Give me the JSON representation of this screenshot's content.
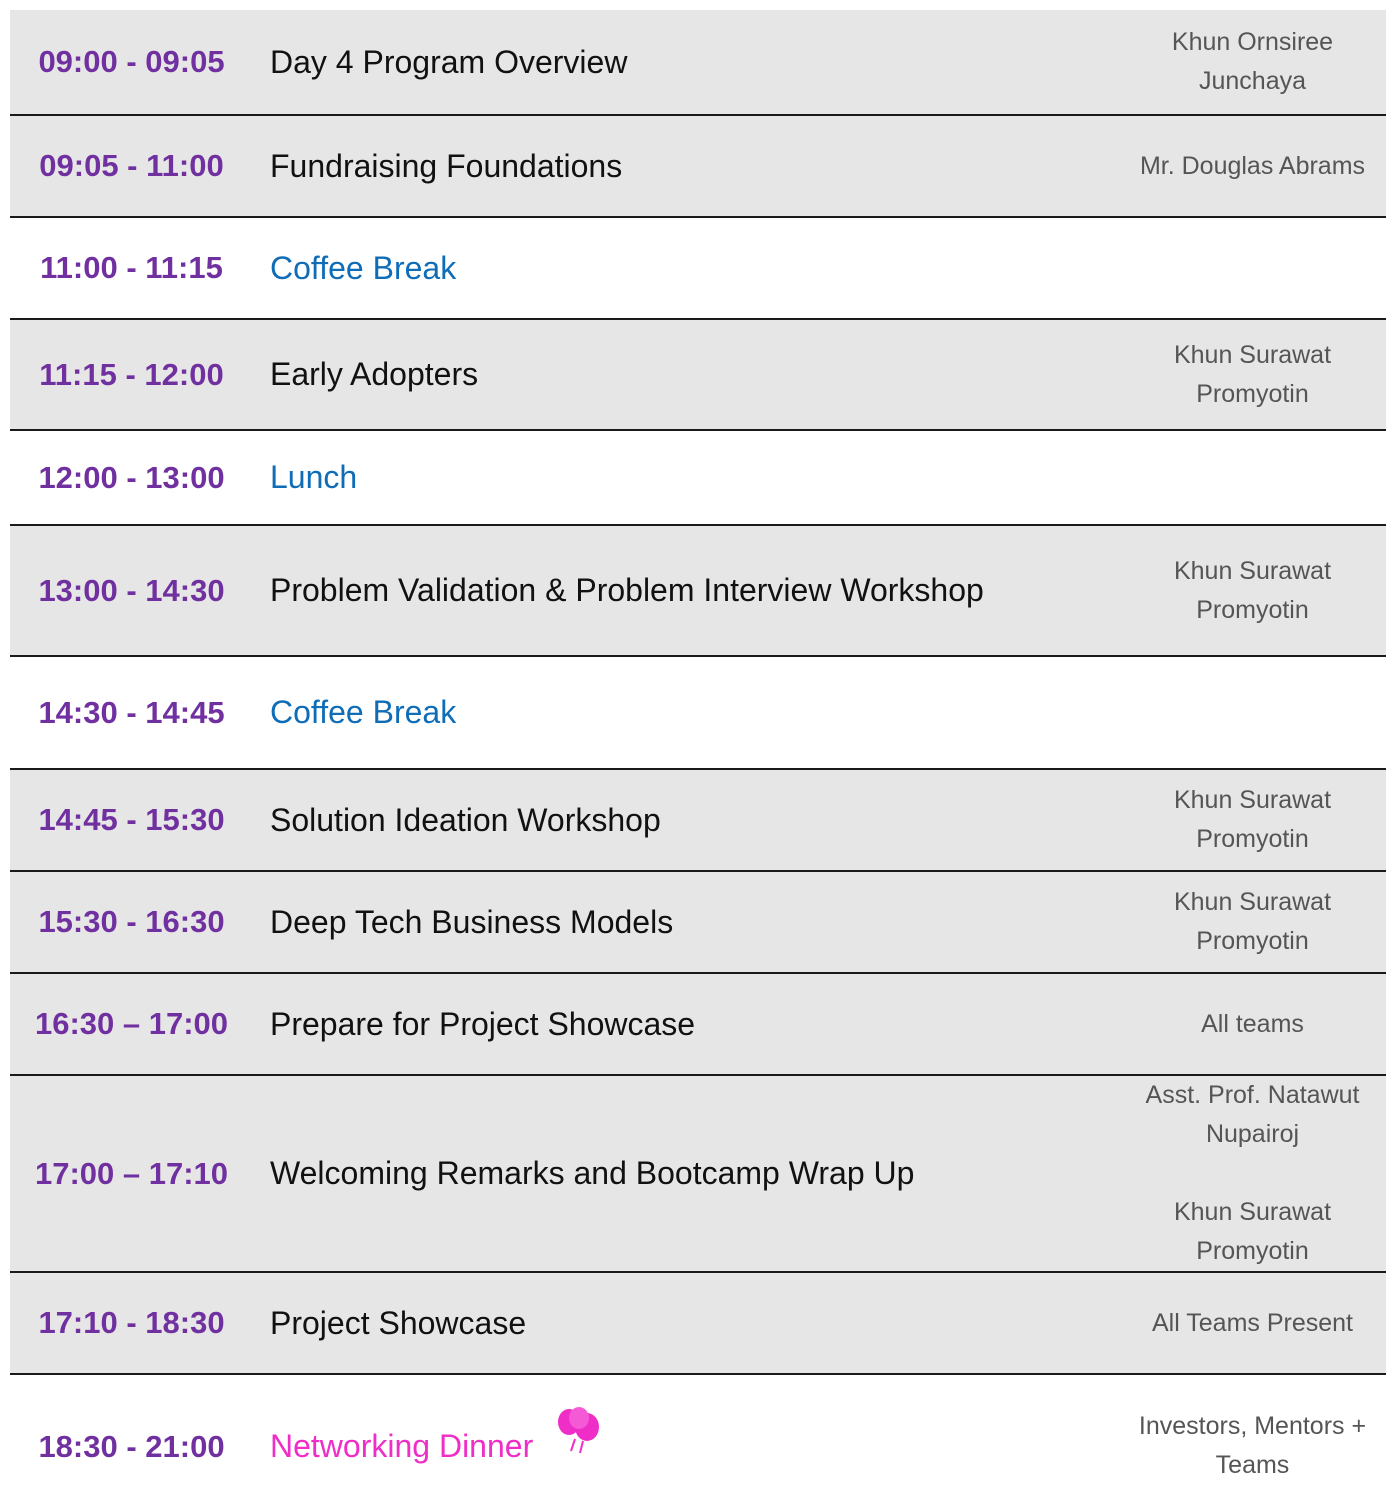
{
  "schedule": [
    {
      "time": "09:00 - 09:05",
      "title": "Day 4 Program Overview",
      "speaker": [
        "Khun Ornsiree",
        "Junchaya"
      ]
    },
    {
      "time": "09:05 - 11:00",
      "title": "Fundraising Foundations",
      "speaker": [
        "Mr. Douglas Abrams"
      ]
    },
    {
      "time": "11:00 - 11:15",
      "title": "Coffee Break"
    },
    {
      "time": "11:15 - 12:00",
      "title": "Early Adopters",
      "speaker": [
        "Khun Surawat",
        "Promyotin"
      ]
    },
    {
      "time": "12:00 - 13:00",
      "title": "Lunch"
    },
    {
      "time": "13:00 - 14:30",
      "title": "Problem Validation & Problem Interview Workshop",
      "speaker": [
        "Khun Surawat",
        "Promyotin"
      ]
    },
    {
      "time": "14:30 - 14:45",
      "title": "Coffee Break"
    },
    {
      "time": "14:45 - 15:30",
      "title": "Solution Ideation Workshop",
      "speaker": [
        "Khun Surawat",
        "Promyotin"
      ]
    },
    {
      "time": "15:30 - 16:30",
      "title": "Deep Tech Business Models",
      "speaker": [
        "Khun Surawat",
        "Promyotin"
      ]
    },
    {
      "time": "16:30 – 17:00",
      "title": "Prepare for Project Showcase",
      "speaker": [
        "All teams"
      ]
    },
    {
      "time": "17:00 – 17:10",
      "title": "Welcoming Remarks and Bootcamp Wrap Up",
      "speaker": [
        "Asst. Prof. Natawut",
        "Nupairoj",
        "Khun Surawat",
        "Promyotin"
      ]
    },
    {
      "time": "17:10 - 18:30",
      "title": "Project Showcase",
      "speaker": [
        "All Teams Present"
      ]
    },
    {
      "time": "18:30 - 21:00",
      "title": "Networking Dinner",
      "speaker": [
        "Investors, Mentors +",
        "Teams"
      ]
    }
  ],
  "colors": {
    "time": "#7030a0",
    "break_title": "#0f6db8",
    "dinner_title": "#ef2ec8",
    "row_shade": "#e7e6e6"
  },
  "icons": {
    "dinner_icon": "balloon-icon"
  }
}
